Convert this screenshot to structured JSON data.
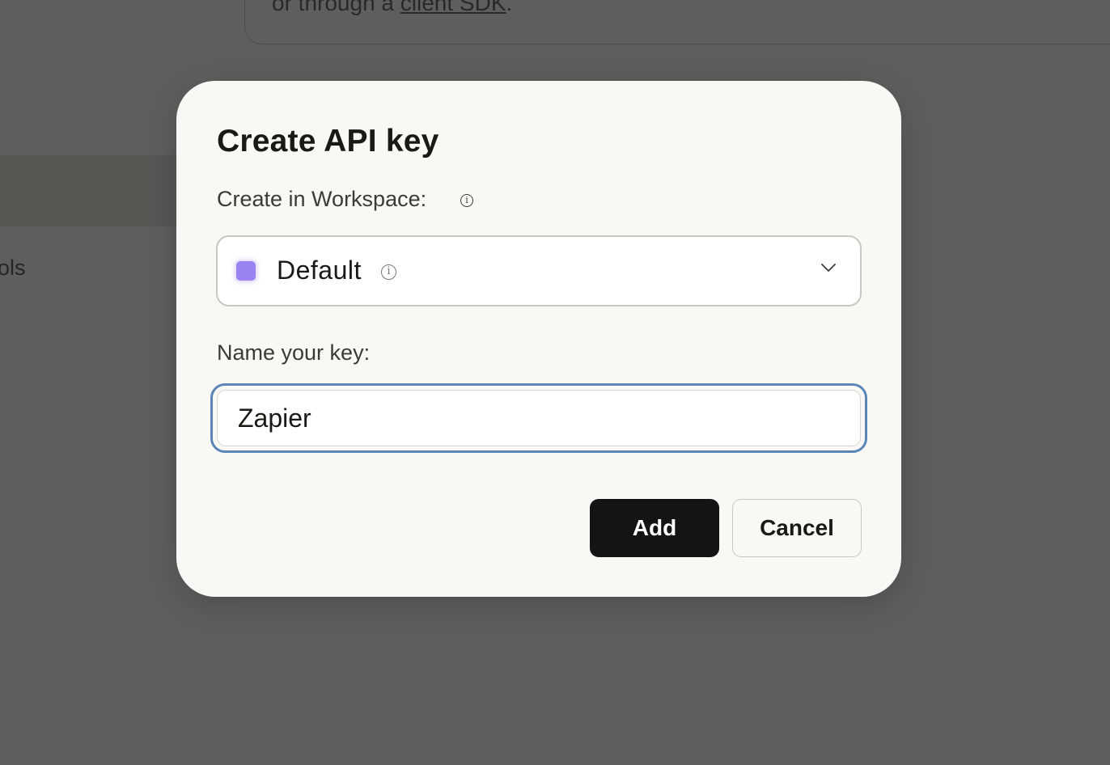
{
  "background": {
    "card_text_prefix": "or through a ",
    "card_link": "client SDK",
    "card_text_suffix": ".",
    "side_text": "rols"
  },
  "modal": {
    "title": "Create API key",
    "workspace_label": "Create in Workspace:",
    "workspace": {
      "selected": "Default",
      "swatch_color": "#9a82f2"
    },
    "name_label": "Name your key:",
    "name_value": "Zapier",
    "add_label": "Add",
    "cancel_label": "Cancel"
  },
  "colors": {
    "focus_ring": "#5b87b8",
    "primary_button": "#141413",
    "overlay": "#5f5e5c"
  },
  "icons": {
    "workspace_info": "info-icon",
    "default_info": "info-icon",
    "dropdown": "chevron-down-icon"
  }
}
